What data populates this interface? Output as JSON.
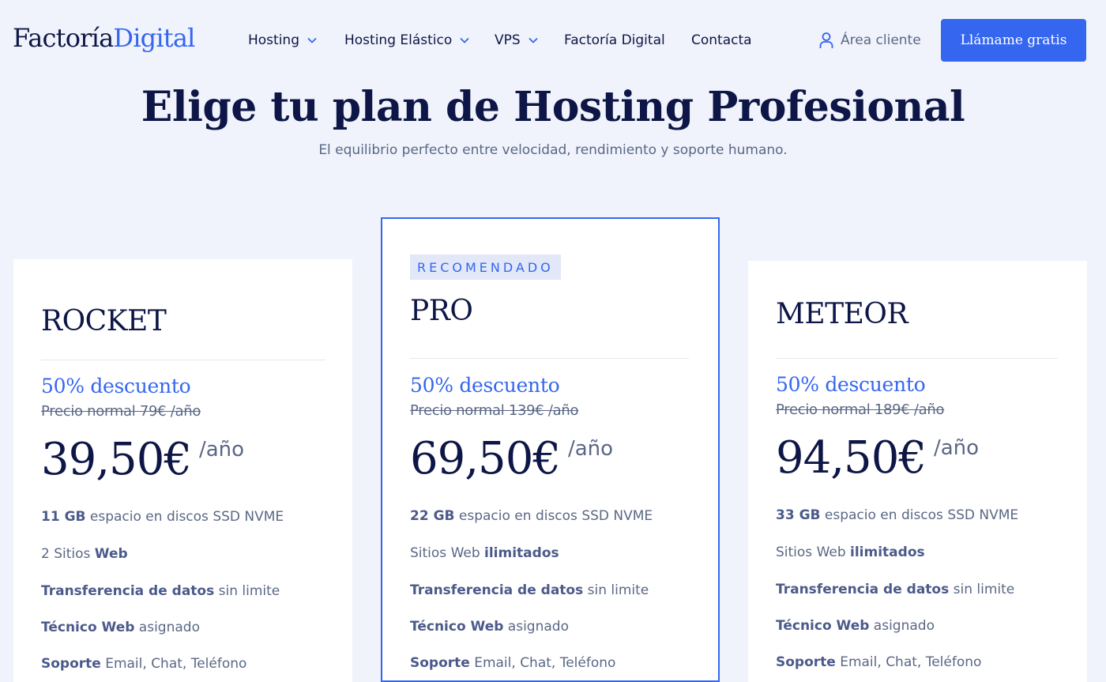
{
  "header": {
    "logo": {
      "part1": "Factoría",
      "part2": "Digital"
    },
    "nav": [
      {
        "label": "Hosting",
        "dropdown": true
      },
      {
        "label": "Hosting Elástico",
        "dropdown": true
      },
      {
        "label": "VPS",
        "dropdown": true
      },
      {
        "label": "Factoría Digital",
        "dropdown": false
      },
      {
        "label": "Contacta",
        "dropdown": false
      }
    ],
    "area_cliente": "Área cliente",
    "cta": "Llámame gratis"
  },
  "hero": {
    "title": "Elige tu plan de Hosting Profesional",
    "subtitle": "El equilibrio perfecto entre velocidad, rendimiento y soporte humano."
  },
  "plans": [
    {
      "name": "ROCKET",
      "badge": "",
      "discount": "50% descuento",
      "normal_price": "Precio normal 79€ /año",
      "price": "39,50€",
      "period": "/año",
      "features": [
        {
          "bold": "11 GB",
          "text": " espacio en discos SSD NVME",
          "bold_first": true
        },
        {
          "bold": "Web",
          "text": "2 Sitios ",
          "bold_first": false
        },
        {
          "bold": "Transferencia de datos",
          "text": " sin limite",
          "bold_first": true
        },
        {
          "bold": "Técnico Web",
          "text": " asignado",
          "bold_first": true
        },
        {
          "bold": "Soporte",
          "text": " Email, Chat, Teléfono",
          "bold_first": true
        }
      ]
    },
    {
      "name": "PRO",
      "badge": "RECOMENDADO",
      "discount": "50% descuento",
      "normal_price": "Precio normal 139€ /año",
      "price": "69,50€",
      "period": "/año",
      "features": [
        {
          "bold": "22 GB",
          "text": " espacio en discos SSD NVME",
          "bold_first": true
        },
        {
          "bold": "ilimitados",
          "text": "Sitios Web ",
          "bold_first": false
        },
        {
          "bold": "Transferencia de datos",
          "text": " sin limite",
          "bold_first": true
        },
        {
          "bold": "Técnico Web",
          "text": " asignado",
          "bold_first": true
        },
        {
          "bold": "Soporte",
          "text": " Email, Chat, Teléfono",
          "bold_first": true
        }
      ]
    },
    {
      "name": "METEOR",
      "badge": "",
      "discount": "50% descuento",
      "normal_price": "Precio normal 189€ /año",
      "price": "94,50€",
      "period": "/año",
      "features": [
        {
          "bold": "33 GB",
          "text": " espacio en discos SSD NVME",
          "bold_first": true
        },
        {
          "bold": "ilimitados",
          "text": "Sitios Web ",
          "bold_first": false
        },
        {
          "bold": "Transferencia de datos",
          "text": " sin limite",
          "bold_first": true
        },
        {
          "bold": "Técnico Web",
          "text": " asignado",
          "bold_first": true
        },
        {
          "bold": "Soporte",
          "text": " Email, Chat, Teléfono",
          "bold_first": true
        }
      ]
    }
  ],
  "colors": {
    "accent": "#3466f0",
    "heading": "#0d1646",
    "muted": "#5a6785",
    "background": "#f0f3fb"
  }
}
